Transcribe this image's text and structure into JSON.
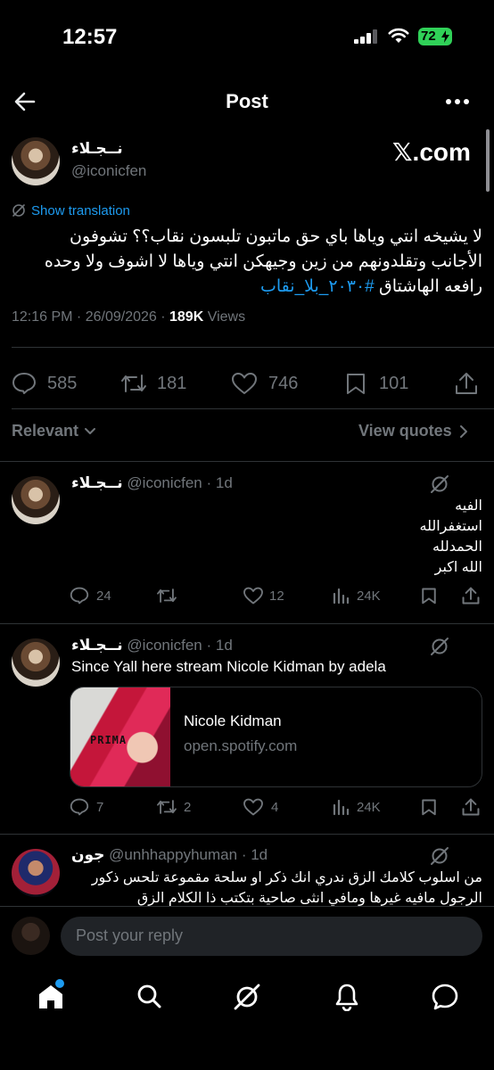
{
  "status_bar": {
    "time": "12:57",
    "battery": "72"
  },
  "header": {
    "title": "Post"
  },
  "post": {
    "author_name": "نــجـلاء",
    "author_handle": "@iconicfen",
    "watermark": "𝕏.com",
    "show_translation": "Show translation",
    "text_line1": "لا يشيخه انتي وياها باي حق ماتبون تلبسون نقاب؟؟ تشوفون",
    "text_line2": "الأجانب وتقلدونهم من زين وجيهكن انتي وياها لا اشوف ولا وحده",
    "text_line3_prefix": "رافعه الهاشتاق ",
    "hashtag": "#٢٠٣٠_بلا_نقاب",
    "timestamp": "12:16 PM · 26/09/2026 · ",
    "views_count": "189K",
    "views_label": " Views",
    "replies": "585",
    "reposts": "181",
    "likes": "746",
    "bookmarks": "101"
  },
  "sort": {
    "relevant": "Relevant",
    "view_quotes": "View quotes"
  },
  "replies": [
    {
      "name": "نــجـلاء",
      "handle": "@iconicfen",
      "time": "· 1d",
      "lines": [
        "الفيه",
        "استغفرالله",
        "الحمدلله",
        "الله اكبر"
      ],
      "replies": "24",
      "reposts": "",
      "likes": "12",
      "views": "24K"
    },
    {
      "name": "نــجـلاء",
      "handle": "@iconicfen",
      "time": "· 1d",
      "text": "Since Yall here stream Nicole Kidman by adela",
      "card_title": "Nicole Kidman",
      "card_domain": "open.spotify.com",
      "card_art_text": "PRIMA",
      "replies": "7",
      "reposts": "2",
      "likes": "4",
      "views": "24K"
    },
    {
      "name": "جون",
      "handle": "@unhhappyhuman",
      "time": "· 1d",
      "line1": "من اسلوب كلامك الزق ندري انك ذكر او سلحة مقموعة تلحس ذكور",
      "line2": "الرجول مافيه غيرها ومافي انثى صاحية بتكتب ذا الكلام الزق"
    }
  ],
  "composer": {
    "placeholder": "Post your reply"
  },
  "colors": {
    "accent": "#1d9bf0",
    "battery": "#30d158",
    "background": "#000000",
    "divider": "#2f3336"
  }
}
